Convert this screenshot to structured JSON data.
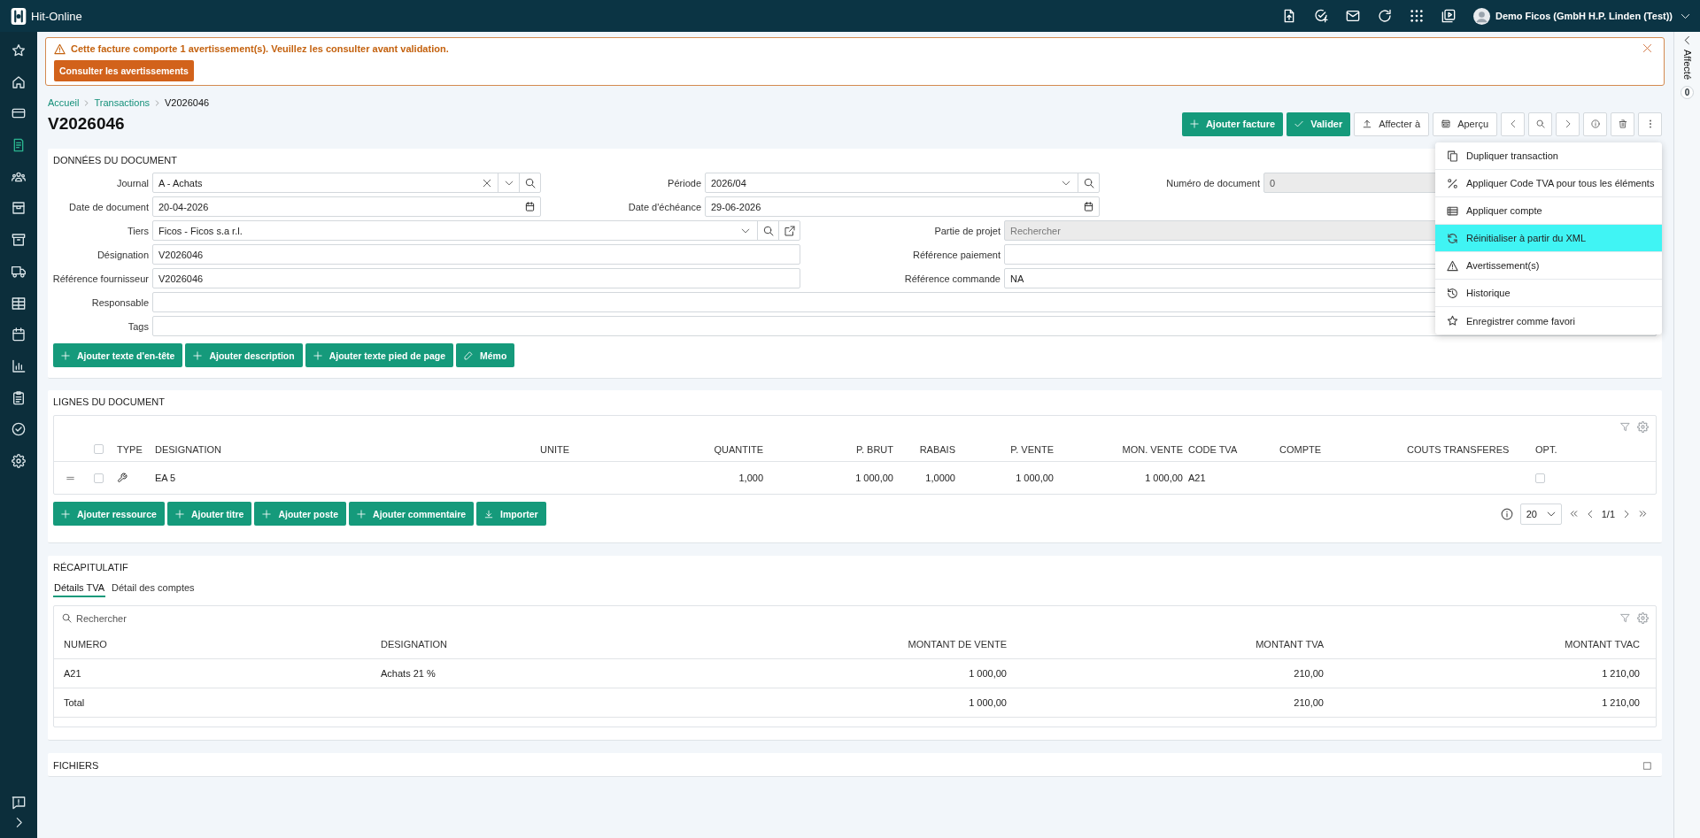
{
  "app": {
    "name": "Hit-Online"
  },
  "user": {
    "name": "Demo Ficos (GmbH H.P. Linden (Test))"
  },
  "sidebar": {
    "items": [
      {
        "selected": false
      },
      {
        "selected": false
      },
      {
        "selected": false
      },
      {
        "selected": true
      },
      {
        "selected": false
      },
      {
        "selected": false
      },
      {
        "selected": false
      },
      {
        "selected": false
      },
      {
        "selected": false
      },
      {
        "selected": false
      },
      {
        "selected": false
      },
      {
        "selected": false
      },
      {
        "selected": false
      },
      {
        "selected": false
      }
    ]
  },
  "alert": {
    "message": "Cette facture comporte 1 avertissement(s). Veuillez les consulter avant validation.",
    "button": "Consulter les avertissements"
  },
  "breadcrumb": [
    {
      "label": "Accueil"
    },
    {
      "label": "Transactions"
    },
    {
      "label": "V2026046"
    }
  ],
  "title": "V2026046",
  "toolbar": {
    "buttons": [
      {
        "label": "Ajouter facture",
        "kind": "primary"
      },
      {
        "label": "Valider",
        "kind": "primary"
      },
      {
        "label": "Affecter à",
        "kind": "secondary"
      },
      {
        "label": "Aperçu",
        "kind": "secondary"
      }
    ]
  },
  "more_menu": {
    "items": [
      {
        "label": "Dupliquer transaction",
        "selected": false
      },
      {
        "label": "Appliquer Code TVA pour tous les éléments",
        "selected": false
      },
      {
        "label": "Appliquer compte",
        "selected": false
      },
      {
        "label": "Réinitialiser à partir du XML",
        "selected": true
      },
      {
        "label": "Avertissement(s)",
        "selected": false
      },
      {
        "label": "Historique",
        "selected": false
      },
      {
        "label": "Enregistrer comme favori",
        "selected": false
      }
    ]
  },
  "document_data": {
    "title": "DONNÉES DU DOCUMENT",
    "rows": [
      {
        "kind": "triple",
        "fields": [
          {
            "label": "Journal",
            "kind": "select",
            "value": "A - Achats",
            "disabled": false,
            "clearable": true
          },
          {
            "label": "Période",
            "kind": "select",
            "value": "2026/04",
            "disabled": false
          },
          {
            "label": "Numéro de document",
            "kind": "text",
            "value": "0",
            "disabled": true
          }
        ]
      },
      {
        "kind": "triple",
        "fields": [
          {
            "label": "Date de document",
            "kind": "date",
            "value": "20-04-2026",
            "disabled": false
          },
          {
            "label": "Date d'échéance",
            "kind": "date",
            "value": "29-06-2026",
            "disabled": false
          }
        ]
      },
      {
        "kind": "pair",
        "fields": [
          {
            "label": "Tiers",
            "kind": "select",
            "value": "Ficos - Ficos s.a r.l.",
            "disabled": false,
            "open_link": true
          },
          {
            "label": "Partie de projet",
            "kind": "text",
            "placeholder": "Rechercher",
            "disabled": true
          }
        ]
      },
      {
        "kind": "pair",
        "fields": [
          {
            "label": "Désignation",
            "kind": "text",
            "value": "V2026046",
            "disabled": false
          },
          {
            "label": "Référence paiement",
            "kind": "text",
            "disabled": false
          }
        ]
      },
      {
        "kind": "pair",
        "fields": [
          {
            "label": "Référence fournisseur",
            "kind": "text",
            "value": "V2026046",
            "disabled": false
          },
          {
            "label": "Référence commande",
            "kind": "text",
            "value": "NA",
            "disabled": false
          }
        ]
      },
      {
        "kind": "single",
        "fields": [
          {
            "label": "Responsable",
            "kind": "text",
            "disabled": false
          }
        ]
      },
      {
        "kind": "single",
        "fields": [
          {
            "label": "Tags",
            "kind": "text",
            "disabled": false
          }
        ]
      }
    ],
    "actions": [
      {
        "label": "Ajouter texte d'en-tête",
        "kind": "add"
      },
      {
        "label": "Ajouter description",
        "kind": "add"
      },
      {
        "label": "Ajouter texte pied de page",
        "kind": "add"
      },
      {
        "label": "Mémo",
        "kind": "edit"
      }
    ]
  },
  "lines": {
    "title": "LIGNES DU DOCUMENT",
    "table": {
      "select_all": false,
      "columns": {
        "type": "TYPE",
        "designation": "DESIGNATION",
        "unite": "UNITE",
        "quantite": "QUANTITE",
        "p_brut": "P. BRUT",
        "rabais": "RABAIS",
        "p_vente": "P. VENTE",
        "mon_vente": "MON. VENTE",
        "code_tva": "CODE TVA",
        "compte": "COMPTE",
        "couts_transferes": "COUTS TRANSFERES",
        "opt": "OPT."
      },
      "rows": [
        {
          "selected": false,
          "designation": "EA 5",
          "quantite": "1,000",
          "p_brut": "1 000,00",
          "rabais": "1,0000",
          "p_vente": "1 000,00",
          "mon_vente": "1 000,00",
          "code_tva": "A21",
          "opt": false
        }
      ]
    },
    "actions": [
      {
        "label": "Ajouter ressource",
        "kind": "add"
      },
      {
        "label": "Ajouter titre",
        "kind": "add"
      },
      {
        "label": "Ajouter poste",
        "kind": "add"
      },
      {
        "label": "Ajouter commentaire",
        "kind": "add"
      },
      {
        "label": "Importer",
        "kind": "import"
      }
    ],
    "pagination": {
      "page_size": "20",
      "page": "1/1"
    }
  },
  "summary": {
    "title": "RÉCAPITULATIF",
    "tabs": [
      {
        "label": "Détails TVA",
        "selected": true
      },
      {
        "label": "Détail des comptes",
        "selected": false
      }
    ],
    "search": {
      "placeholder": "Rechercher"
    },
    "table": {
      "columns": {
        "numero": "NUMERO",
        "designation": "DESIGNATION",
        "montant_vente": "MONTANT DE VENTE",
        "montant_tva": "MONTANT TVA",
        "montant_tvac": "MONTANT TVAC"
      },
      "rows": [
        {
          "numero": "A21",
          "designation": "Achats 21 %",
          "montant_vente": "1 000,00",
          "montant_tva": "210,00",
          "montant_tvac": "1 210,00"
        },
        {
          "numero": "Total",
          "montant_vente": "1 000,00",
          "montant_tva": "210,00",
          "montant_tvac": "1 210,00"
        }
      ]
    }
  },
  "files": {
    "title": "FICHIERS"
  },
  "side_panel": {
    "label": "Affecté",
    "count": "0"
  }
}
